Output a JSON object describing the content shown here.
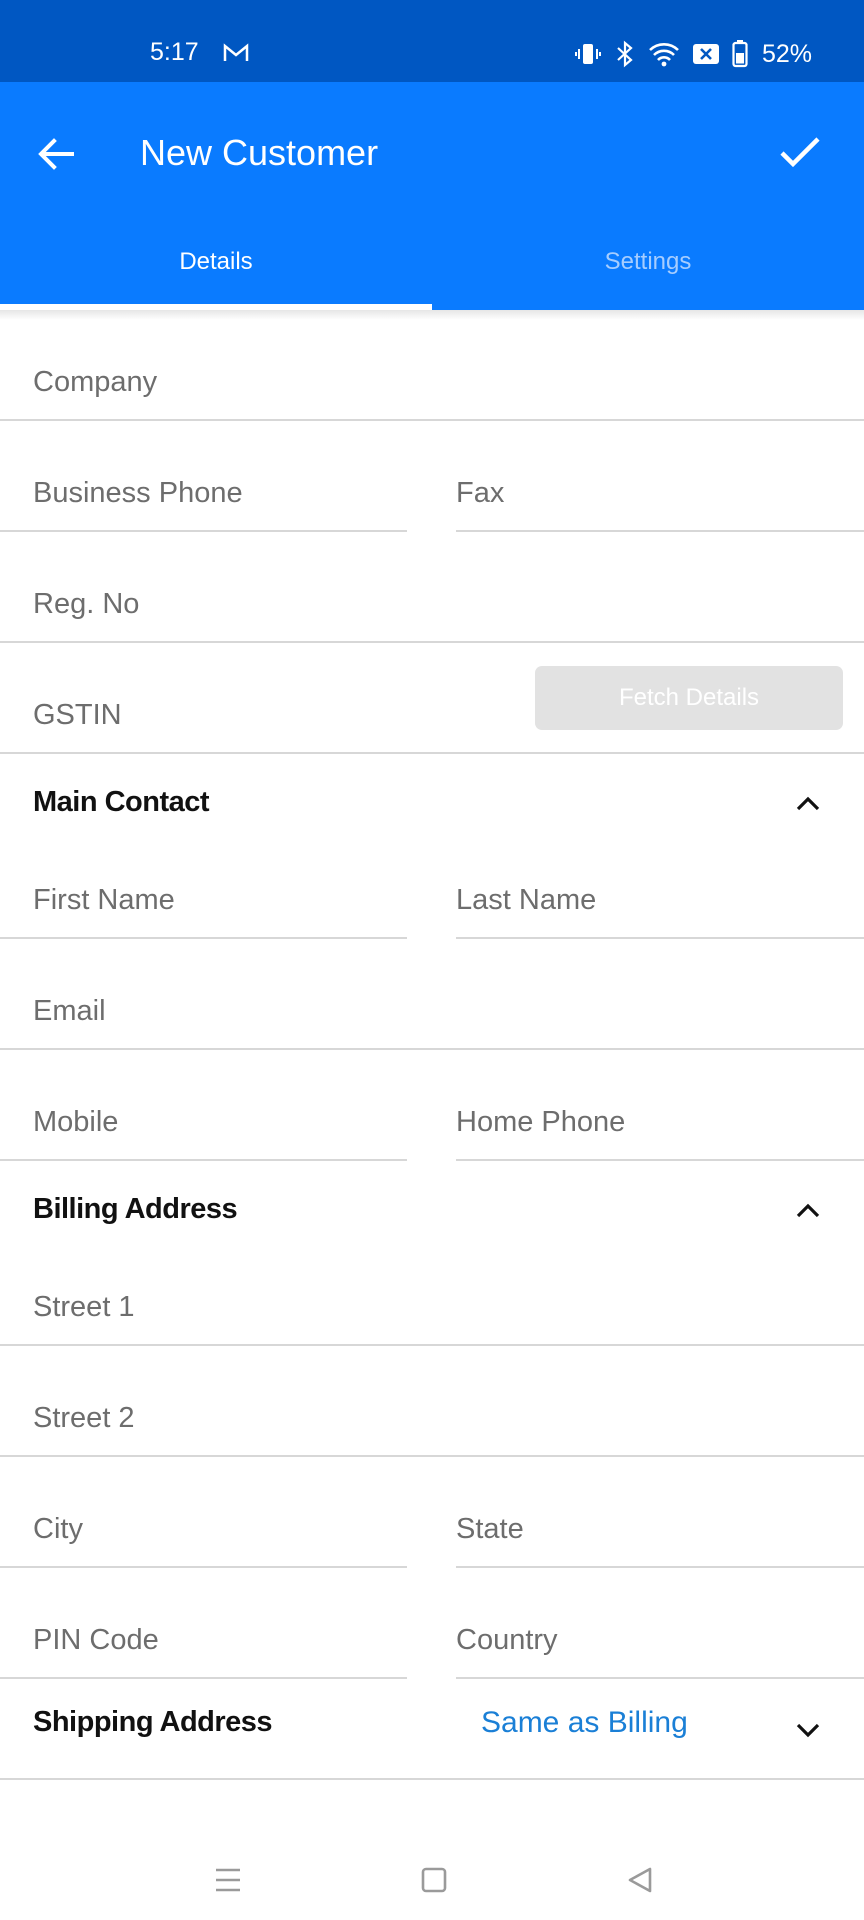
{
  "status_bar": {
    "time": "5:17",
    "battery": "52%"
  },
  "app_bar": {
    "title": "New Customer"
  },
  "tabs": [
    {
      "label": "Details",
      "active": true
    },
    {
      "label": "Settings",
      "active": false
    }
  ],
  "fields": {
    "company": "Company",
    "business_phone": "Business Phone",
    "fax": "Fax",
    "reg_no": "Reg. No",
    "gstin": "GSTIN",
    "first_name": "First Name",
    "last_name": "Last Name",
    "email": "Email",
    "mobile": "Mobile",
    "home_phone": "Home Phone",
    "street1": "Street 1",
    "street2": "Street 2",
    "city": "City",
    "state": "State",
    "pin_code": "PIN Code",
    "country": "Country"
  },
  "buttons": {
    "fetch_details": "Fetch Details"
  },
  "sections": {
    "main_contact": "Main Contact",
    "billing_address": "Billing Address",
    "shipping_address": "Shipping Address",
    "shipping_option": "Same as Billing"
  },
  "colors": {
    "status_bar": "#0057c2",
    "app_bar": "#0a7bff",
    "link": "#1a7fd6"
  },
  "icons": {
    "back": "arrow-left-icon",
    "save": "check-icon",
    "collapse": "chevron-up-icon",
    "expand": "chevron-down-icon",
    "nav_menu": "menu-icon",
    "nav_home": "square-icon",
    "nav_back": "triangle-back-icon"
  }
}
